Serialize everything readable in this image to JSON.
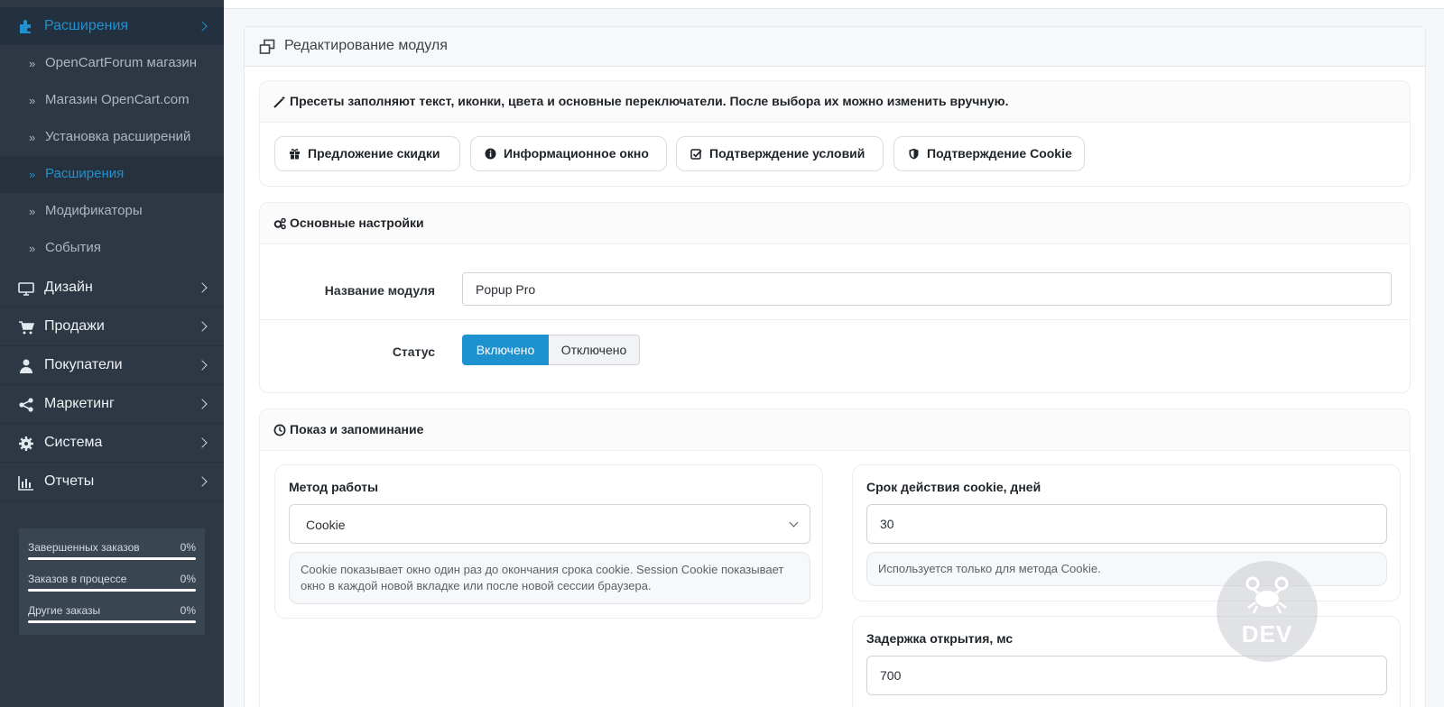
{
  "sidebar": {
    "active_section": "Расширения",
    "sub_items": [
      {
        "label": "OpenCartForum магазин",
        "active": false
      },
      {
        "label": "Магазин OpenCart.com",
        "active": false
      },
      {
        "label": "Установка расширений",
        "active": false
      },
      {
        "label": "Расширения",
        "active": true
      },
      {
        "label": "Модификаторы",
        "active": false
      },
      {
        "label": "События",
        "active": false
      }
    ],
    "main_items": [
      {
        "label": "Дизайн",
        "icon": "monitor-icon"
      },
      {
        "label": "Продажи",
        "icon": "cart-icon"
      },
      {
        "label": "Покупатели",
        "icon": "user-icon"
      },
      {
        "label": "Маркетинг",
        "icon": "share-icon"
      },
      {
        "label": "Система",
        "icon": "gear-icon"
      },
      {
        "label": "Отчеты",
        "icon": "bar-chart-icon"
      }
    ],
    "stats": [
      {
        "label": "Завершенных заказов",
        "value": "0%",
        "percent": 0
      },
      {
        "label": "Заказов в процессе",
        "value": "0%",
        "percent": 0
      },
      {
        "label": "Другие заказы",
        "value": "0%",
        "percent": 0
      }
    ]
  },
  "panel": {
    "title": "Редактирование модуля"
  },
  "presets": {
    "heading": "Пресеты заполняют текст, иконки, цвета и основные переключатели. После выбора их можно изменить вручную.",
    "buttons": [
      {
        "label": "Предложение скидки",
        "icon": "gift-icon"
      },
      {
        "label": "Информационное окно",
        "icon": "info-icon"
      },
      {
        "label": "Подтверждение условий",
        "icon": "checkbox-icon"
      },
      {
        "label": "Подтверждение Cookie",
        "icon": "shield-icon"
      }
    ]
  },
  "basic": {
    "heading": "Основные настройки",
    "name_label": "Название модуля",
    "name_value": "Popup Pro",
    "status_label": "Статус",
    "status_on": "Включено",
    "status_off": "Отключено",
    "status_selected": "Включено"
  },
  "display": {
    "heading": "Показ и запоминание",
    "method_label": "Метод работы",
    "method_value": "Cookie",
    "method_hint": "Cookie показывает окно один раз до окончания срока cookie. Session Cookie показывает окно в каждой новой вкладке или после новой сессии браузера.",
    "cookie_days_label": "Срок действия cookie, дней",
    "cookie_days_value": "30",
    "cookie_days_hint": "Используется только для метода Cookie.",
    "delay_label": "Задержка открытия, мс",
    "delay_value": "700"
  },
  "watermark": {
    "text": "DEV"
  },
  "colors": {
    "accent": "#1e91cf",
    "sidebar_bg": "#2d3844"
  }
}
